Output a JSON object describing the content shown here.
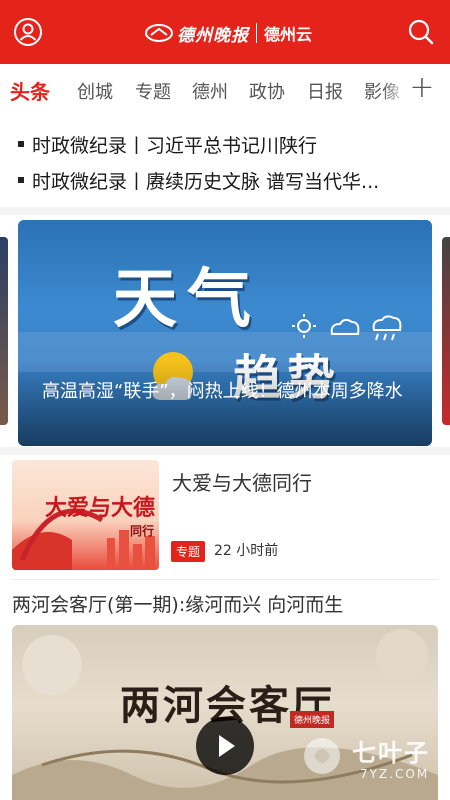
{
  "header": {
    "logo_text": "德州晚报",
    "app_name": "德州云",
    "icons": [
      "user-icon",
      "search-icon"
    ],
    "brand_color": "#e4231b"
  },
  "tabs": [
    {
      "label": "头条",
      "active": true
    },
    {
      "label": "创城"
    },
    {
      "label": "专题"
    },
    {
      "label": "德州"
    },
    {
      "label": "政协"
    },
    {
      "label": "日报"
    },
    {
      "label": "影像"
    }
  ],
  "tab_add": "+",
  "headlines": [
    "时政微纪录丨习近平总书记川陕行",
    "时政微纪录丨赓续历史文脉 谱写当代华..."
  ],
  "carousel": {
    "image_text_line1": "天气",
    "image_text_line2": "趋势",
    "caption": "高温高湿“联手”，闷热上线！德州本周多降水"
  },
  "news_item": {
    "title": "大爱与大德同行",
    "thumb_text": "大爱与大德",
    "thumb_text2": "同行",
    "tag": "专题",
    "time": "22 小时前"
  },
  "video_item": {
    "title": "两河会客厅(第一期):缘河而兴 向河而生",
    "image_text": "两河会客厅",
    "image_badge": "德州晚报"
  },
  "watermark": {
    "text": "七叶子",
    "sub": "7YZ.COM"
  }
}
